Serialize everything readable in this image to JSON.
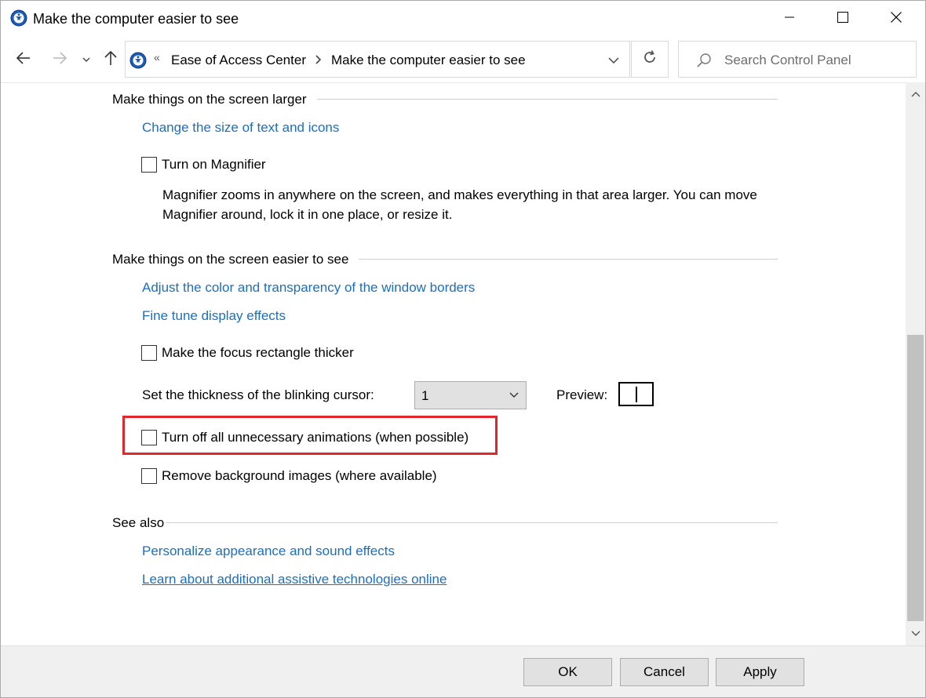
{
  "window": {
    "title": "Make the computer easier to see",
    "controls": {
      "minimize": "minimize-icon",
      "maximize": "maximize-icon",
      "close": "close-icon"
    }
  },
  "navigation": {
    "back_icon": "back-arrow-icon",
    "forward_icon": "forward-arrow-icon",
    "recent_icon": "chevron-down-icon",
    "up_icon": "up-arrow-icon",
    "address": {
      "overflow": "«",
      "breadcrumbs": [
        "Ease of Access Center",
        "Make the computer easier to see"
      ]
    },
    "refresh_icon": "refresh-icon",
    "search": {
      "placeholder": "Search Control Panel"
    }
  },
  "sections": {
    "larger": {
      "heading": "Make things on the screen larger",
      "link": "Change the size of text and icons",
      "magnifier_checkbox": {
        "label": "Turn on Magnifier",
        "checked": false
      },
      "magnifier_desc": "Magnifier zooms in anywhere on the screen, and makes everything in that area larger. You can move Magnifier around, lock it in one place, or resize it."
    },
    "easier": {
      "heading": "Make things on the screen easier to see",
      "links": [
        "Adjust the color and transparency of the window borders",
        "Fine tune display effects"
      ],
      "focus_checkbox": {
        "label": "Make the focus rectangle thicker",
        "checked": false
      },
      "cursor_label": "Set the thickness of the blinking cursor:",
      "cursor_value": "1",
      "preview_label": "Preview:",
      "animations_checkbox": {
        "label": "Turn off all unnecessary animations (when possible)",
        "checked": false
      },
      "background_checkbox": {
        "label": "Remove background images (where available)",
        "checked": false
      }
    },
    "see_also": {
      "heading": "See also",
      "links": [
        "Personalize appearance and sound effects",
        "Learn about additional assistive technologies online"
      ]
    }
  },
  "footer": {
    "ok": "OK",
    "cancel": "Cancel",
    "apply": "Apply"
  },
  "colors": {
    "link": "#1a6fc4",
    "highlight": "#e3262d",
    "footer_bg": "#f0f0f0",
    "button_bg": "#e1e1e1"
  }
}
